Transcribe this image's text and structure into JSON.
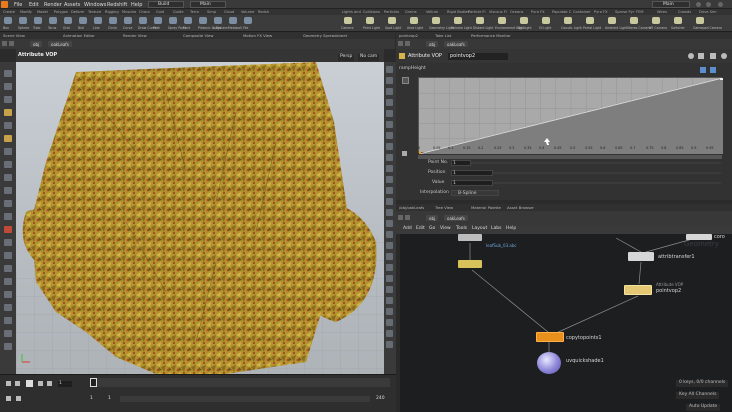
{
  "menubar": {
    "items": [
      "File",
      "Edit",
      "Render",
      "Assets",
      "Windows",
      "Redshift",
      "Help"
    ],
    "build_label": "Build",
    "desktop_left": "Main",
    "desktop_right": "Main"
  },
  "shelf": {
    "tabs": [
      "Create",
      "Modify",
      "Model",
      "Polygon",
      "Deform",
      "Texture",
      "Rigging",
      "Muscles",
      "Chara",
      "Guid",
      "Guide",
      "Terra",
      "Simp",
      "Cloud",
      "Volume",
      "Redsh"
    ],
    "right_tabs": [
      "Lights and",
      "Collisions",
      "Particles",
      "Grains",
      "Vellum",
      "Rigid Bodies",
      "Particle Fl",
      "Viscous Fl",
      "Oceans",
      "Pyro FX",
      "Populate C",
      "Container",
      "Pyro FX",
      "Sparse Pyr",
      "FEM",
      "Wires",
      "Crowds",
      "Drive Sim"
    ],
    "tools": [
      "Box",
      "Sphere",
      "Tube",
      "Torus",
      "Grid",
      "Null",
      "Line",
      "Circle",
      "Curve",
      "Draw Curve",
      "Path",
      "Spray Paint",
      "Font",
      "Platonic Solids",
      "L-System",
      "Metaball",
      "File"
    ],
    "right_tools": [
      "Camera",
      "Point Light",
      "Spot Light",
      "Area Light",
      "Geometry Light",
      "Volume Light",
      "Distant Light",
      "Environment Light",
      "Sky Light",
      "GI Light",
      "Caustic Light",
      "Portal Light",
      "Ambient Light",
      "Stereo Camera",
      "VR Camera",
      "Switcher",
      "Gamepad Camera"
    ]
  },
  "left_pane": {
    "tabs": [
      "Scene View",
      "Animation Editor",
      "Render View",
      "Composite View",
      "Motion FX View",
      "Geometry Spreadsheet"
    ],
    "path": [
      "obj",
      "oakLeafs"
    ],
    "viewport_title": "Attribute VOP",
    "persp": "Persp",
    "cam": "No cam"
  },
  "right_pane": {
    "tabs": [
      "pointvop2",
      "Take List",
      "Performance Monitor"
    ],
    "path": [
      "obj",
      "oakLeafs"
    ],
    "node_type": "Attribute VOP",
    "node_name": "pointvop2",
    "ramp_label": "rampHeight",
    "ramp_ticks": [
      "0",
      "0.05",
      "0.1",
      "0.15",
      "0.2",
      "0.25",
      "0.3",
      "0.35",
      "0.4",
      "0.45",
      "0.5",
      "0.55",
      "0.6",
      "0.65",
      "0.7",
      "0.75",
      "0.8",
      "0.85",
      "0.9",
      "0.95"
    ],
    "params": [
      {
        "label": "Point No.",
        "value": "1"
      },
      {
        "label": "Position",
        "value": "1"
      },
      {
        "label": "Value",
        "value": "1"
      },
      {
        "label": "Interpolation",
        "value": "B-Spline"
      }
    ]
  },
  "network": {
    "tabs": [
      "/obj/oakLeafs",
      "Tree View",
      "Material Palette",
      "Asset Browser"
    ],
    "path": [
      "obj",
      "oakLeafs"
    ],
    "menu": [
      "Add",
      "Edit",
      "Go",
      "View",
      "Tools",
      "Layout",
      "Labs",
      "Help"
    ],
    "watermark": "Geometry",
    "nodes": {
      "top_node_label": "leafSub_03.abc",
      "attribtransfer": "attribtransfer1",
      "pointvop": "pointvop2",
      "pointvop_sub": "Attribute VOP",
      "copytopoints": "copytopoints1",
      "quickshade": "uvquickshade1",
      "corner": "coro"
    }
  },
  "timeline": {
    "frame": "1",
    "start": "1",
    "end": "1",
    "range_end": "240",
    "range_end2": "240"
  },
  "status": {
    "keys": "0 keys, 0/0 channels",
    "all_channels": "Key All Channels",
    "auto_update": "Auto Update"
  },
  "colors": {
    "accent": "#f0a020",
    "node_orange": "#e8901c",
    "node_yellow": "#d7c35a",
    "ramp_fill": "#8a8a8a"
  }
}
